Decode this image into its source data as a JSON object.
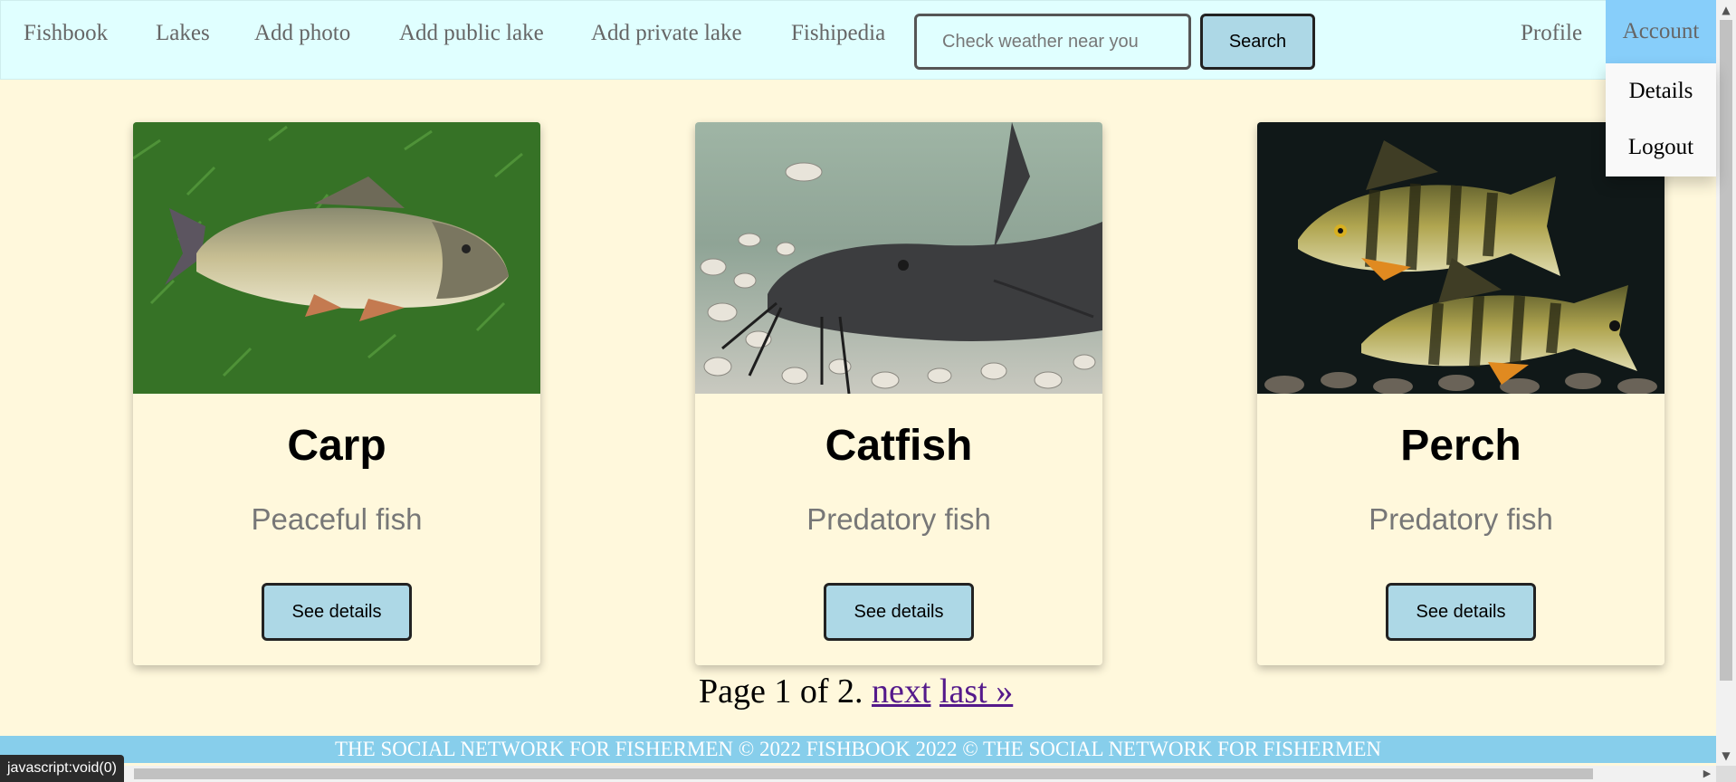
{
  "navbar": {
    "items": [
      "Fishbook",
      "Lakes",
      "Add photo",
      "Add public lake",
      "Add private lake",
      "Fishipedia"
    ],
    "search_placeholder": "Check weather near you",
    "search_label": "Search",
    "profile_label": "Profile",
    "account_label": "Account",
    "dropdown": [
      "Details",
      "Logout"
    ]
  },
  "cards": [
    {
      "title": "Carp",
      "subtitle": "Peaceful fish",
      "button": "See details"
    },
    {
      "title": "Catfish",
      "subtitle": "Predatory fish",
      "button": "See details"
    },
    {
      "title": "Perch",
      "subtitle": "Predatory fish",
      "button": "See details"
    }
  ],
  "pagination": {
    "text": "Page 1 of 2.",
    "next": "next",
    "last": "last »"
  },
  "footer": {
    "text": "THE SOCIAL NETWORK FOR FISHERMEN © 2022 FISHBOOK 2022 © THE SOCIAL NETWORK FOR FISHERMEN"
  },
  "status_bar": {
    "text": "javascript:void(0)"
  },
  "colors": {
    "page_bg": "#fff8dc",
    "navbar_bg": "#e0ffff",
    "button_bg": "#add8e6",
    "account_bg": "#87cefa",
    "footer_bg": "#87ceeb"
  }
}
